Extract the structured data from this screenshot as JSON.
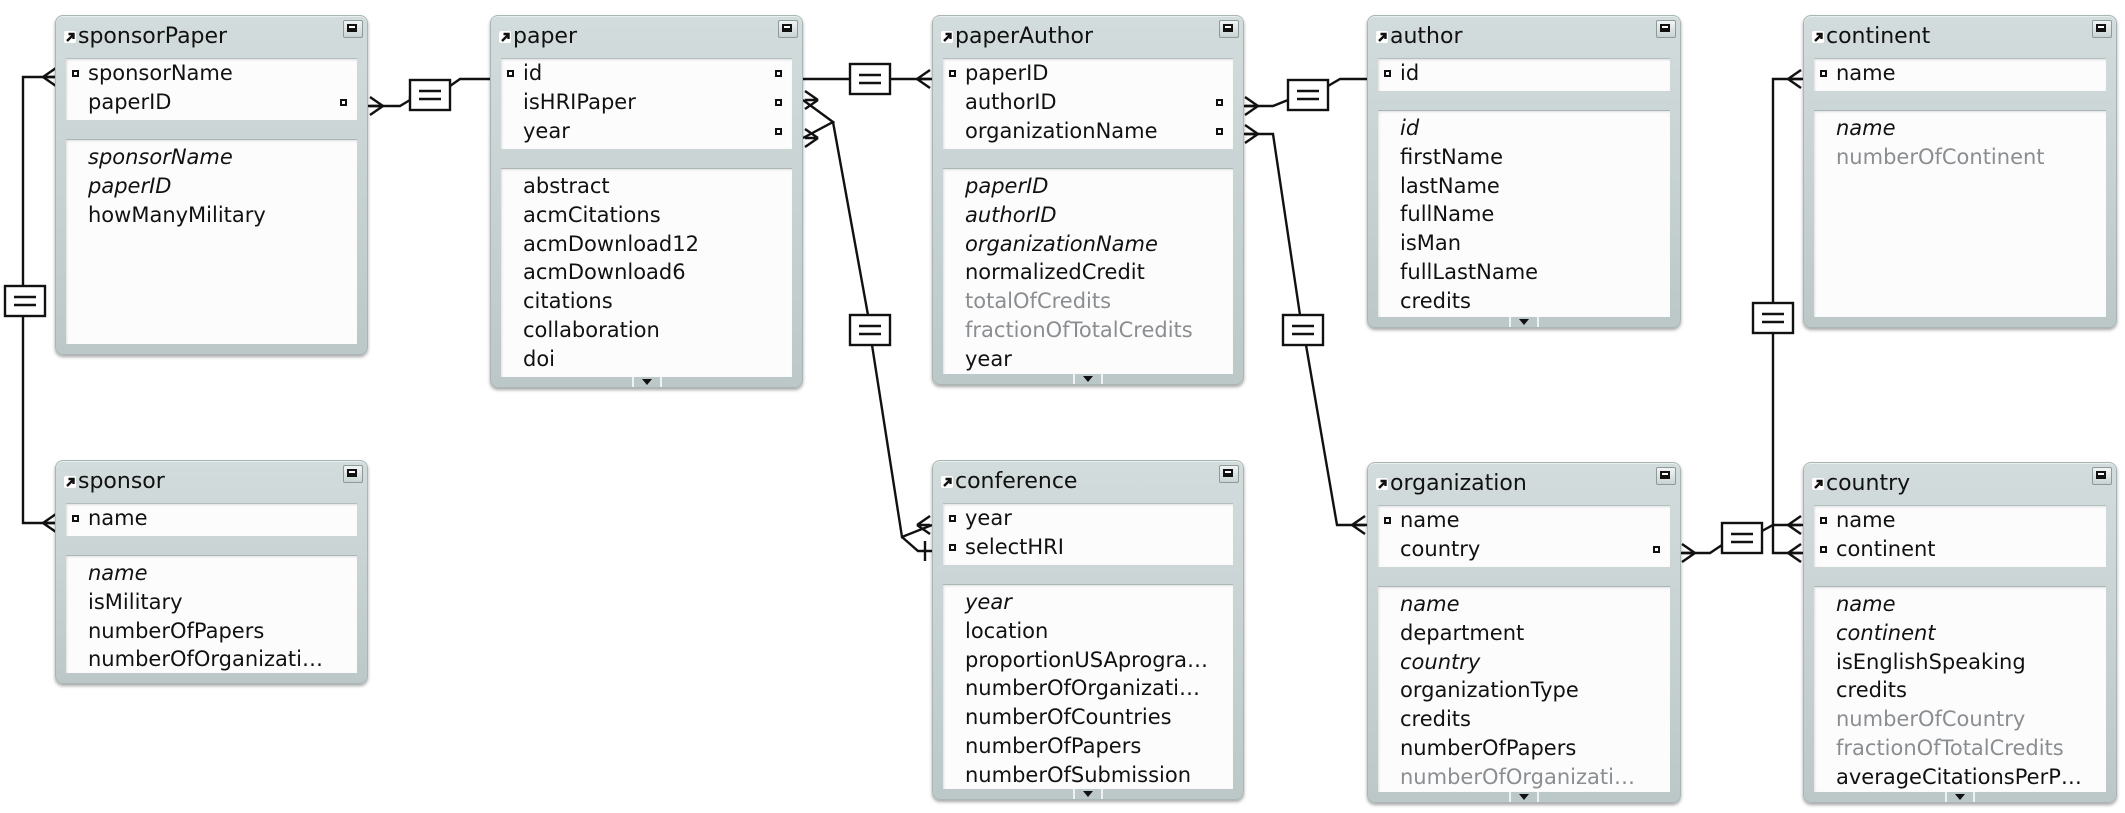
{
  "diagram": {
    "type": "relationship-graph",
    "tables": [
      {
        "id": "sponsorPaper",
        "name": "sponsorPaper",
        "keys": [
          {
            "name": "sponsorName",
            "left_anchor": true,
            "right_anchor": false
          },
          {
            "name": "paperID",
            "left_anchor": false,
            "right_anchor": true
          }
        ],
        "fields": [
          {
            "name": "sponsorName",
            "style": "italic"
          },
          {
            "name": "paperID",
            "style": "italic"
          },
          {
            "name": "howManyMilitary",
            "style": "normal"
          }
        ],
        "has_more": false
      },
      {
        "id": "sponsor",
        "name": "sponsor",
        "keys": [
          {
            "name": "name",
            "left_anchor": true,
            "right_anchor": false
          }
        ],
        "fields": [
          {
            "name": "name",
            "style": "italic"
          },
          {
            "name": "isMilitary",
            "style": "normal"
          },
          {
            "name": "numberOfPapers",
            "style": "normal"
          },
          {
            "name": "numberOfOrganizati…",
            "style": "normal"
          }
        ],
        "has_more": false
      },
      {
        "id": "paper",
        "name": "paper",
        "keys": [
          {
            "name": "id",
            "left_anchor": true,
            "right_anchor": true
          },
          {
            "name": "isHRIPaper",
            "left_anchor": false,
            "right_anchor": true
          },
          {
            "name": "year",
            "left_anchor": false,
            "right_anchor": true
          }
        ],
        "fields": [
          {
            "name": "abstract",
            "style": "normal"
          },
          {
            "name": "acmCitations",
            "style": "normal"
          },
          {
            "name": "acmDownload12",
            "style": "normal"
          },
          {
            "name": "acmDownload6",
            "style": "normal"
          },
          {
            "name": "citations",
            "style": "normal"
          },
          {
            "name": "collaboration",
            "style": "normal"
          },
          {
            "name": "doi",
            "style": "normal"
          }
        ],
        "has_more": true
      },
      {
        "id": "paperAuthor",
        "name": "paperAuthor",
        "keys": [
          {
            "name": "paperID",
            "left_anchor": true,
            "right_anchor": false
          },
          {
            "name": "authorID",
            "left_anchor": false,
            "right_anchor": true
          },
          {
            "name": "organizationName",
            "left_anchor": false,
            "right_anchor": true
          }
        ],
        "fields": [
          {
            "name": "paperID",
            "style": "italic"
          },
          {
            "name": "authorID",
            "style": "italic"
          },
          {
            "name": "organizationName",
            "style": "italic"
          },
          {
            "name": "normalizedCredit",
            "style": "normal"
          },
          {
            "name": "totalOfCredits",
            "style": "calc"
          },
          {
            "name": "fractionOfTotalCredits",
            "style": "calc"
          },
          {
            "name": "year",
            "style": "normal"
          }
        ],
        "has_more": true
      },
      {
        "id": "author",
        "name": "author",
        "keys": [
          {
            "name": "id",
            "left_anchor": true,
            "right_anchor": false
          }
        ],
        "fields": [
          {
            "name": "id",
            "style": "italic"
          },
          {
            "name": "firstName",
            "style": "normal"
          },
          {
            "name": "lastName",
            "style": "normal"
          },
          {
            "name": "fullName",
            "style": "normal"
          },
          {
            "name": "isMan",
            "style": "normal"
          },
          {
            "name": "fullLastName",
            "style": "normal"
          },
          {
            "name": "credits",
            "style": "normal"
          }
        ],
        "has_more": true
      },
      {
        "id": "continent",
        "name": "continent",
        "keys": [
          {
            "name": "name",
            "left_anchor": true,
            "right_anchor": false
          }
        ],
        "fields": [
          {
            "name": "name",
            "style": "italic"
          },
          {
            "name": "numberOfContinent",
            "style": "calc"
          }
        ],
        "has_more": false
      },
      {
        "id": "conference",
        "name": "conference",
        "keys": [
          {
            "name": "year",
            "left_anchor": true,
            "right_anchor": false
          },
          {
            "name": "selectHRI",
            "left_anchor": true,
            "right_anchor": false
          }
        ],
        "fields": [
          {
            "name": "year",
            "style": "italic"
          },
          {
            "name": "location",
            "style": "normal"
          },
          {
            "name": "proportionUSAprogra…",
            "style": "normal"
          },
          {
            "name": "numberOfOrganizati…",
            "style": "normal"
          },
          {
            "name": "numberOfCountries",
            "style": "normal"
          },
          {
            "name": "numberOfPapers",
            "style": "normal"
          },
          {
            "name": "numberOfSubmission",
            "style": "normal"
          }
        ],
        "has_more": true
      },
      {
        "id": "organization",
        "name": "organization",
        "keys": [
          {
            "name": "name",
            "left_anchor": true,
            "right_anchor": false
          },
          {
            "name": "country",
            "left_anchor": false,
            "right_anchor": true
          }
        ],
        "fields": [
          {
            "name": "name",
            "style": "italic"
          },
          {
            "name": "department",
            "style": "normal"
          },
          {
            "name": "country",
            "style": "italic"
          },
          {
            "name": "organizationType",
            "style": "normal"
          },
          {
            "name": "credits",
            "style": "normal"
          },
          {
            "name": "numberOfPapers",
            "style": "normal"
          },
          {
            "name": "numberOfOrganizati…",
            "style": "calc"
          }
        ],
        "has_more": true
      },
      {
        "id": "country",
        "name": "country",
        "keys": [
          {
            "name": "name",
            "left_anchor": true,
            "right_anchor": false
          },
          {
            "name": "continent",
            "left_anchor": true,
            "right_anchor": false
          }
        ],
        "fields": [
          {
            "name": "name",
            "style": "italic"
          },
          {
            "name": "continent",
            "style": "italic"
          },
          {
            "name": "isEnglishSpeaking",
            "style": "normal"
          },
          {
            "name": "credits",
            "style": "normal"
          },
          {
            "name": "numberOfCountry",
            "style": "calc"
          },
          {
            "name": "fractionOfTotalCredits",
            "style": "calc"
          },
          {
            "name": "averageCitationsPerP…",
            "style": "normal"
          }
        ],
        "has_more": true
      }
    ],
    "relationships": [
      {
        "id": "sponsorPaper-sponsor",
        "from": "sponsorPaper.sponsorName",
        "to": "sponsor.name",
        "operator": "="
      },
      {
        "id": "sponsorPaper-paper",
        "from": "sponsorPaper.paperID",
        "to": "paper.id",
        "operator": "="
      },
      {
        "id": "paper-paperAuthor",
        "from": "paper.id",
        "to": "paperAuthor.paperID",
        "operator": "="
      },
      {
        "id": "paper-conference",
        "from": "paper.isHRIPaper,paper.year",
        "to": "conference.selectHRI,conference.year",
        "operator": "="
      },
      {
        "id": "paperAuthor-author",
        "from": "paperAuthor.authorID",
        "to": "author.id",
        "operator": "="
      },
      {
        "id": "paperAuthor-organization",
        "from": "paperAuthor.organizationName",
        "to": "organization.name",
        "operator": "="
      },
      {
        "id": "organization-country",
        "from": "organization.country",
        "to": "country.name",
        "operator": "="
      },
      {
        "id": "country-continent",
        "from": "country.continent",
        "to": "continent.name",
        "operator": "="
      }
    ]
  },
  "colors": {
    "line": "#111111",
    "calc_field": "#8a8e91",
    "table_frame": "#c5cfcf"
  }
}
